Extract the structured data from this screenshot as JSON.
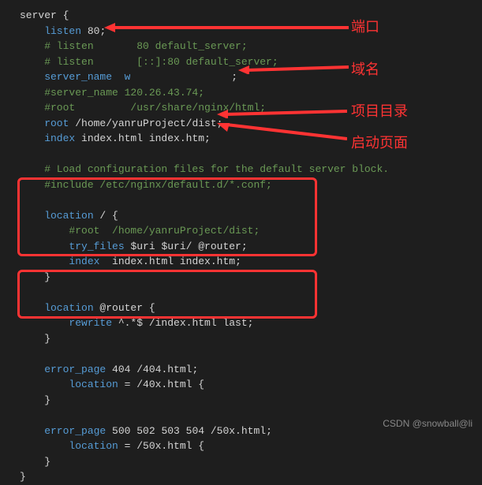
{
  "code": {
    "l1": "server {",
    "l2_a": "    listen ",
    "l2_b": "80",
    "l2_c": ";",
    "l3": "    # listen       80 default_server;",
    "l4": "    # listen       [::]:80 default_server;",
    "l5_a": "    server_name  w",
    "l5_b": " ;",
    "l6": "    #server_name 120.26.43.74;",
    "l7": "    #root         /usr/share/nginx/html;",
    "l8_a": "    root ",
    "l8_b": "/home/yanruProject/dist",
    "l8_c": ";",
    "l9_a": "    index ",
    "l9_b": "index.html index.htm",
    "l9_c": ";",
    "l10": " ",
    "l11": "    # Load configuration files for the default server block.",
    "l12": "    #include /etc/nginx/default.d/*.conf;",
    "l13": " ",
    "l14_a": "    location ",
    "l14_b": "/ ",
    "l14_c": "{",
    "l15": "        #root  /home/yanruProject/dist;",
    "l16_a": "        try_files ",
    "l16_b": "$uri $uri/ @router",
    "l16_c": ";",
    "l17_a": "        index  ",
    "l17_b": "index.html index.htm",
    "l17_c": ";",
    "l18": "    }",
    "l19": " ",
    "l20_a": "    location ",
    "l20_b": "@router ",
    "l20_c": "{",
    "l21_a": "        rewrite ",
    "l21_b": "^.*$ /index.html last",
    "l21_c": ";",
    "l22": "    }",
    "l23": " ",
    "l24_a": "    error_page ",
    "l24_b": "404 /404.html",
    "l24_c": ";",
    "l25_a": "        location ",
    "l25_b": "= /40x.html ",
    "l25_c": "{",
    "l26": "    }",
    "l27": " ",
    "l28_a": "    error_page ",
    "l28_b": "500 502 503 504 /50x.html",
    "l28_c": ";",
    "l29_a": "        location ",
    "l29_b": "= /50x.html ",
    "l29_c": "{",
    "l30": "    }",
    "l31": "}"
  },
  "annotations": {
    "port": "端口",
    "domain": "域名",
    "project_dir": "项目目录",
    "start_page": "启动页面"
  },
  "watermark": "CSDN @snowball@li"
}
